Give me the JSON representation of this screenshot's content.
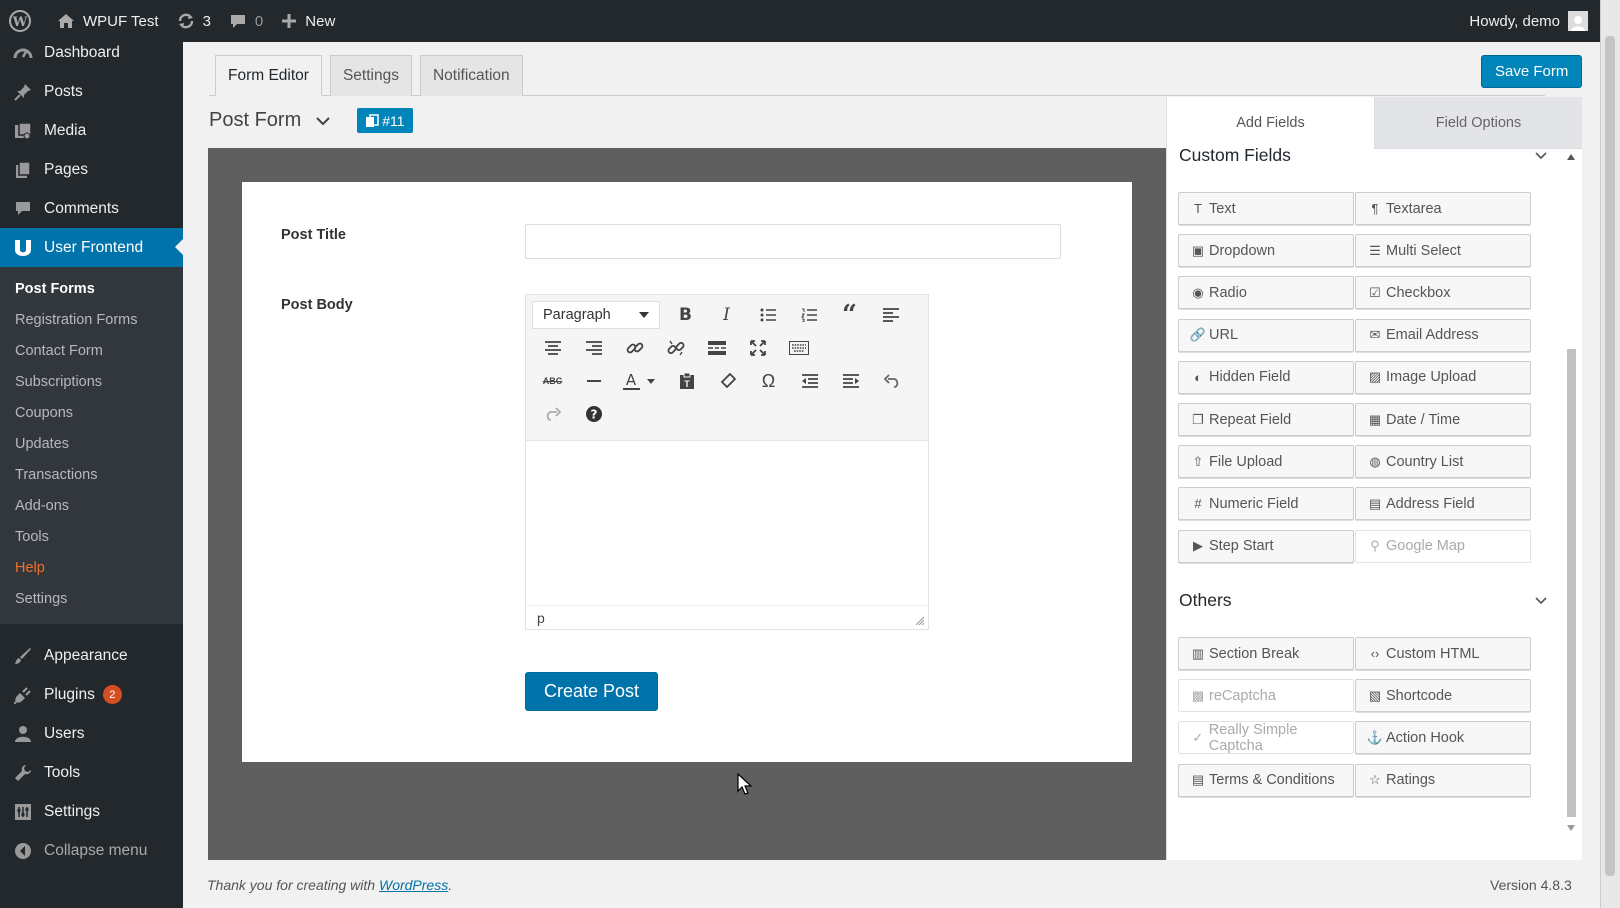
{
  "adminbar": {
    "site_name": "WPUF Test",
    "updates_count": "3",
    "comments_count": "0",
    "new_label": "New",
    "howdy": "Howdy, demo"
  },
  "menu": {
    "dashboard": "Dashboard",
    "posts": "Posts",
    "media": "Media",
    "pages": "Pages",
    "comments": "Comments",
    "user_frontend": "User Frontend",
    "submenu": [
      "Post Forms",
      "Registration Forms",
      "Contact Form",
      "Subscriptions",
      "Coupons",
      "Updates",
      "Transactions",
      "Add-ons",
      "Tools",
      "Help",
      "Settings"
    ],
    "appearance": "Appearance",
    "plugins": "Plugins",
    "plugins_badge": "2",
    "users": "Users",
    "tools": "Tools",
    "settings": "Settings",
    "collapse": "Collapse menu"
  },
  "tabs": [
    "Form Editor",
    "Settings",
    "Notification"
  ],
  "save_label": "Save Form",
  "form": {
    "name": "Post Form",
    "id_label": "#11",
    "post_title_label": "Post Title",
    "post_body_label": "Post Body",
    "format_select": "Paragraph",
    "status_path": "p",
    "submit_label": "Create Post"
  },
  "panel": {
    "tab_add": "Add Fields",
    "tab_options": "Field Options",
    "custom_title": "Custom Fields",
    "custom_fields": [
      {
        "label": "Text",
        "icon": "text-icon"
      },
      {
        "label": "Textarea",
        "icon": "paragraph-icon"
      },
      {
        "label": "Dropdown",
        "icon": "dropdown-icon"
      },
      {
        "label": "Multi Select",
        "icon": "list-icon"
      },
      {
        "label": "Radio",
        "icon": "radio-icon"
      },
      {
        "label": "Checkbox",
        "icon": "checkbox-icon"
      },
      {
        "label": "URL",
        "icon": "link-icon"
      },
      {
        "label": "Email Address",
        "icon": "envelope-icon"
      },
      {
        "label": "Hidden Field",
        "icon": "eye-slash-icon"
      },
      {
        "label": "Image Upload",
        "icon": "image-icon"
      },
      {
        "label": "Repeat Field",
        "icon": "clone-icon"
      },
      {
        "label": "Date / Time",
        "icon": "calendar-icon"
      },
      {
        "label": "File Upload",
        "icon": "upload-icon"
      },
      {
        "label": "Country List",
        "icon": "globe-icon"
      },
      {
        "label": "Numeric Field",
        "icon": "hash-icon"
      },
      {
        "label": "Address Field",
        "icon": "address-card-icon"
      },
      {
        "label": "Step Start",
        "icon": "step-icon"
      },
      {
        "label": "Google Map",
        "icon": "map-marker-icon",
        "disabled": true
      }
    ],
    "others_title": "Others",
    "other_fields": [
      {
        "label": "Section Break",
        "icon": "columns-icon"
      },
      {
        "label": "Custom HTML",
        "icon": "code-icon"
      },
      {
        "label": "reCaptcha",
        "icon": "qrcode-icon",
        "disabled": true
      },
      {
        "label": "Shortcode",
        "icon": "shortcode-icon"
      },
      {
        "label": "Really Simple Captcha",
        "icon": "check-circle-icon",
        "disabled": true
      },
      {
        "label": "Action Hook",
        "icon": "anchor-icon"
      },
      {
        "label": "Terms & Conditions",
        "icon": "file-text-icon"
      },
      {
        "label": "Ratings",
        "icon": "star-icon"
      }
    ]
  },
  "footer": {
    "thanks_prefix": "Thank you for creating with ",
    "thanks_link": "WordPress",
    "thanks_suffix": ".",
    "version": "Version 4.8.3"
  },
  "colors": {
    "admin_dark": "#23282d",
    "accent_blue": "#0073aa",
    "help_orange": "#f56e28",
    "stage_gray": "#5f5f5f"
  }
}
